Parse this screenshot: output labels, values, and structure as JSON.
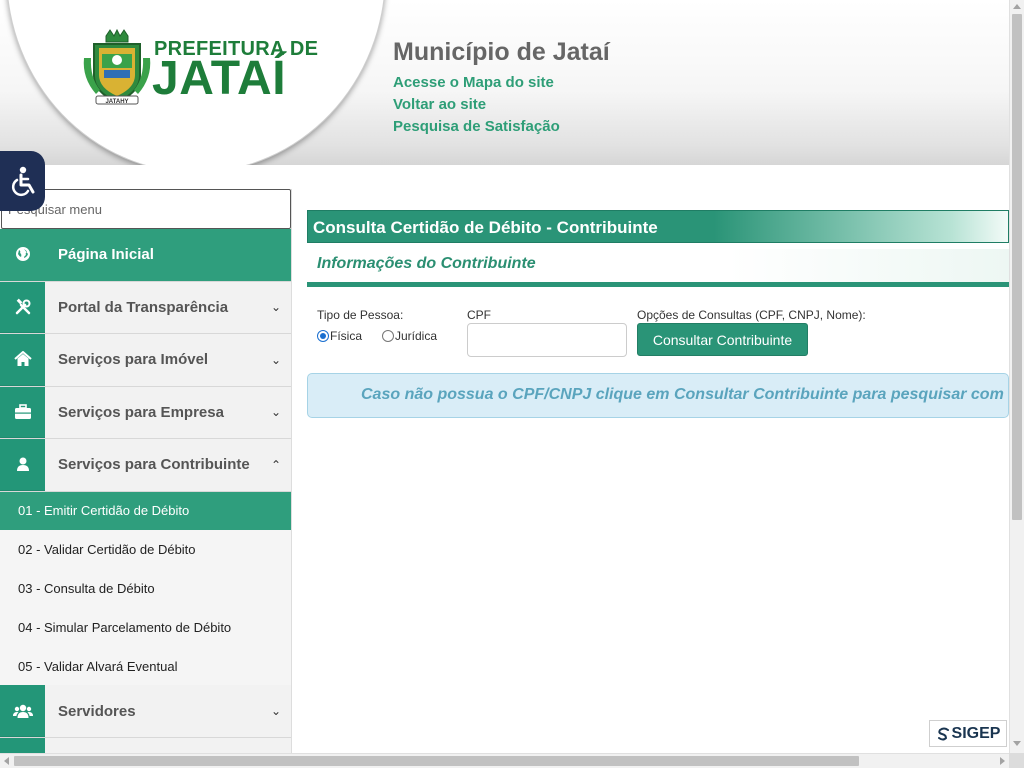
{
  "header": {
    "logo_line1": "PREFEITURA DE",
    "logo_line2": "JATAÍ",
    "logo_banner": "JATAHY",
    "site_title": "Município de Jataí",
    "links": [
      "Acesse o Mapa do site",
      "Voltar ao site",
      "Pesquisa de Satisfação"
    ]
  },
  "accessibility": {
    "icon": "wheelchair-icon"
  },
  "sidebar": {
    "search_placeholder": "Pesquisar menu",
    "items": [
      {
        "label": "Página Inicial",
        "icon": "globe-icon",
        "active": true
      },
      {
        "label": "Portal da Transparência",
        "icon": "tools-icon",
        "chevron": "down"
      },
      {
        "label": "Serviços para Imóvel",
        "icon": "home-icon",
        "chevron": "down"
      },
      {
        "label": "Serviços para Empresa",
        "icon": "briefcase-icon",
        "chevron": "down"
      },
      {
        "label": "Serviços para Contribuinte",
        "icon": "user-icon",
        "chevron": "up"
      },
      {
        "label": "Servidores",
        "icon": "users-icon",
        "chevron": "down"
      }
    ],
    "submenu": [
      {
        "label": "01 - Emitir Certidão de Débito",
        "active": true
      },
      {
        "label": "02 - Validar Certidão de Débito"
      },
      {
        "label": "03 - Consulta de Débito"
      },
      {
        "label": "04 - Simular Parcelamento de Débito"
      },
      {
        "label": "05 - Validar Alvará Eventual"
      }
    ]
  },
  "main": {
    "panel_title": "Consulta Certidão de Débito - Contribuinte",
    "section_title": "Informações do Contribuinte",
    "tipo_label": "Tipo de Pessoa:",
    "radio_fisica": "Física",
    "radio_juridica": "Jurídica",
    "selected_tipo": "Física",
    "cpf_label": "CPF",
    "cpf_value": "",
    "opcoes_label": "Opções de Consultas (CPF, CNPJ, Nome):",
    "consult_button": "Consultar Contribuinte",
    "info_text": "Caso não possua o CPF/CNPJ clique em Consultar Contribuinte para pesquisar com o nome."
  },
  "footer": {
    "sigep_text": "SIGEP"
  },
  "colors": {
    "primary": "#2a9477",
    "link": "#2e9e77",
    "access": "#1f2f55",
    "info_bg": "#d9edf7",
    "info_text": "#5aa4bd"
  }
}
